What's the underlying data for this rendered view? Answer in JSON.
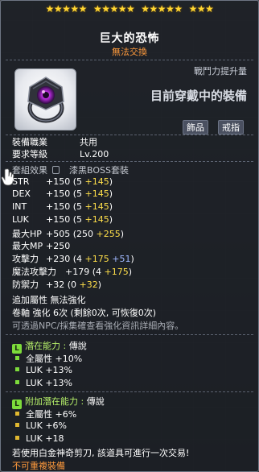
{
  "item": {
    "name": "巨大的恐怖",
    "trade_status": "無法交換",
    "star_groups": [
      5,
      5,
      5,
      3
    ]
  },
  "compare": {
    "power_label": "戰鬥力提升量",
    "equipped_label": "目前穿戴中的裝備",
    "categories": [
      "飾品",
      "戒指"
    ]
  },
  "requirements": {
    "job_label": "裝備職業",
    "job_value": "共用",
    "level_label": "要求等級",
    "level_value": "Lv.200"
  },
  "set": {
    "label": "套組效果",
    "name": "漆黑BOSS套裝"
  },
  "stats": [
    {
      "name": "STR",
      "total": "+150",
      "open": "(5",
      "bonus": "+145",
      "close": ")"
    },
    {
      "name": "DEX",
      "total": "+150",
      "open": "(5",
      "bonus": "+145",
      "close": ")"
    },
    {
      "name": "INT",
      "total": "+150",
      "open": "(5",
      "bonus": "+145",
      "close": ")"
    },
    {
      "name": "LUK",
      "total": "+150",
      "open": "(5",
      "bonus": "+145",
      "close": ")"
    }
  ],
  "stats2": {
    "maxhp": {
      "name": "最大HP",
      "total": "+505",
      "open": "(250",
      "bonus": "+255",
      "close": ")"
    },
    "maxmp": {
      "name": "最大MP",
      "total": "+250"
    },
    "atk": {
      "name": "攻擊力",
      "total": "+230",
      "open": "(4",
      "bonus": "+175",
      "bonus2": "+51",
      "close": ")"
    },
    "matk": {
      "name": "魔法攻擊力",
      "total": "+179",
      "open": "(4",
      "bonus": "+175",
      "close": ")"
    },
    "def": {
      "name": "防禦力",
      "total": "+32",
      "open": "(0",
      "bonus": "+32",
      "close": ")"
    }
  },
  "extra": {
    "attribute": "追加屬性 無法強化",
    "scroll": "卷軸 強化 6次 (剩餘0次, 可恢復0次)",
    "npc_hint": "可透過NPC/採集確查看強化資訊詳細內容。"
  },
  "potential": {
    "badge": "L",
    "title": "潛在能力 :",
    "grade": "傳說",
    "lines": [
      "全屬性 +10%",
      "LUK +13%",
      "LUK +13%"
    ]
  },
  "bonus_potential": {
    "badge": "L",
    "title": "附加潛在能力 :",
    "grade": "傳說",
    "lines": [
      "全屬性 +6%",
      "LUK +6%",
      "LUK +18"
    ]
  },
  "notes": {
    "scissors": "若使用白金神奇剪刀, 該道具可進行一次交易!",
    "no_repeat": "不可重複裝備"
  },
  "colors": {
    "trade": "#ff9a3c",
    "bonus_green": "#7cff5c",
    "bonus_yellow": "#ffdf4a",
    "bonus_blue": "#9fb8ff",
    "legendary": "#7ddc3b"
  }
}
